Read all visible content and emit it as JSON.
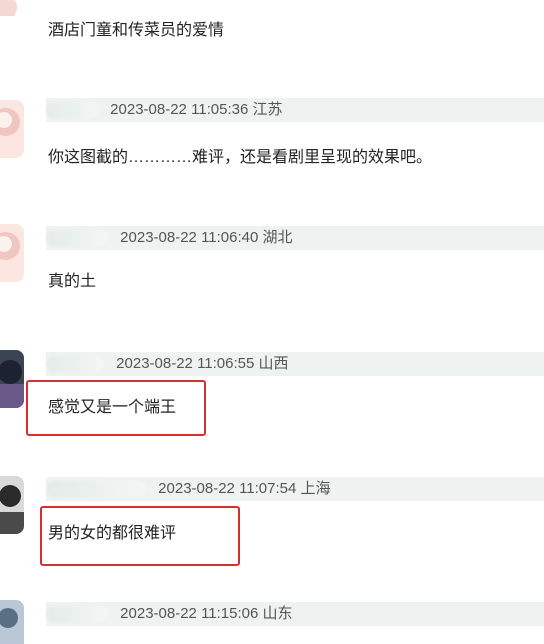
{
  "comments": [
    {
      "content": "酒店门童和传菜员的爱情"
    },
    {
      "time": "2023-08-22 11:05:36",
      "location": "江苏",
      "content": "你这图截的…………难评，还是看剧里呈现的效果吧。"
    },
    {
      "time": "2023-08-22 11:06:40",
      "location": "湖北",
      "content": "真的土"
    },
    {
      "time": "2023-08-22 11:06:55",
      "location": "山西",
      "content": "感觉又是一个端王"
    },
    {
      "time": "2023-08-22 11:07:54",
      "location": "上海",
      "content": "男的女的都很难评"
    },
    {
      "time": "2023-08-22 11:15:06",
      "location": "山东"
    }
  ],
  "colors": {
    "highlight": "#d43030",
    "meta_bg": "#eef3f1"
  }
}
